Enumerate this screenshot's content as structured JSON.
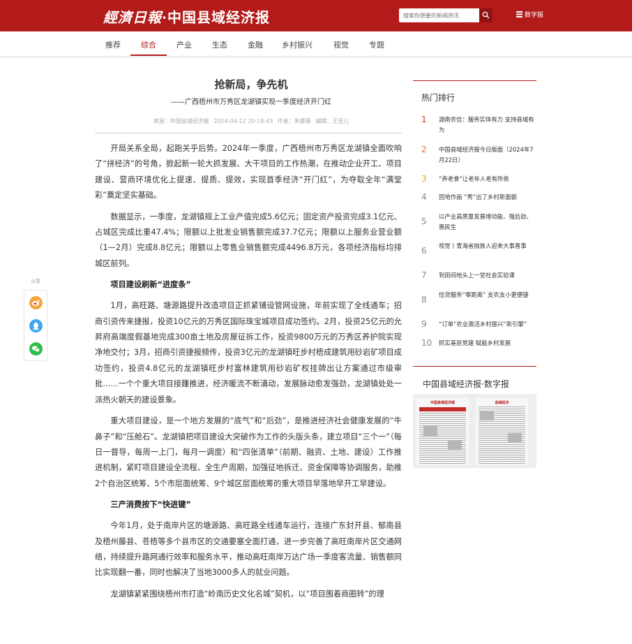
{
  "header": {
    "logo_script": "經濟日報",
    "logo_main": "中国县域经济报",
    "search_placeholder": "搜索你想要的新闻资讯",
    "digital_label": "数字报"
  },
  "nav": {
    "items": [
      "推荐",
      "综合",
      "产业",
      "生态",
      "金融",
      "乡村振兴",
      "视觉",
      "专题"
    ],
    "active": "综合"
  },
  "article": {
    "title": "抢新局，争先机",
    "subtitle": "——广西梧州市万秀区龙湖镇实现一季度经济开门红",
    "meta": {
      "source": "来源：中国县域经济报",
      "date": "2024-04-12 20:18:43",
      "author": "作者：朱娜蓉",
      "editor": "编辑：王昱儿"
    },
    "p1": "开局关系全局，起跑关乎后势。2024年一季度，广西梧州市万秀区龙湖镇全面吹响了“拼经济”的号角，掀起新一轮大抓发展、大干项目的工作热潮，在推动企业开工、项目建设、营商环境优化上提速、提质、提效，实现首季经济“开门红”，为夺取全年“满堂彩”奠定坚实基础。",
    "p2": "数据显示，一季度，龙湖镇规上工业产值完成5.6亿元；固定资产投资完成3.1亿元、占城区完成比重47.4%；限额以上批发业销售额完成37.7亿元；限额以上服务业营业额（1—2月）完成8.8亿元；限额以上零售业销售额完成4496.8万元，各项经济指标均排城区前列。",
    "h1": "项目建设刷新“进度条”",
    "p3": "1月，高旺路、塘源路提升改造项目正抓紧铺设管网设施，年前实现了全线通车；招商引资传来捷报，投资10亿元的万秀区国际珠宝城项目成功签约。2月，投资25亿元的允昇府高端度假基地完成300亩土地及房屋征拆工作，投资9800万元的万秀区养护院实现净地交付；3月，招商引资捷报频传，投资3亿元的龙湖镇旺步村梧成建筑用砂岩矿项目成功签约，投资4.8亿元的龙湖镇旺步村富林建筑用砂岩矿权挂牌出让方案通过市级审批……一个个重大项目接踵推进，经济暖流不断涌动，发展脉动愈发强劲，龙湖镇处处一派热火朝天的建设景象。",
    "p4": "重大项目建设，是一个地方发展的“底气”和“后劲”，是推进经济社会健康发展的“牛鼻子”和“压舱石”。龙湖镇把项目建设大突破作为工作的头版头条，建立项目“三个一”（每日一督导，每周一上门，每月一调度）和“四张清单”（前期、融资、土地、建设）工作推进机制，紧盯项目建设全流程、全生产周期，加强征地拆迁、资金保障等协调服务，助推2个自治区统筹、5个市层面统筹、9个城区层面统筹的重大项目早落地早开工早建设。",
    "h2": "三产消费按下“快进键”",
    "p5": "今年1月，处于南岸片区的塘源路、高旺路全线通车运行，连接广东封开县、郁南县及梧州藤县、苍梧等多个县市区的交通要塞全面打通，进一步完善了高旺南岸片区交通网络，持续提升路网通行效率和服务水平，推动高旺南岸万达广场一季度客流量、销售额同比实现翻一番，同时也解决了当地3000多人的就业问题。",
    "p6": "龙湖镇紧紧围绕梧州市打造“岭南历史文化名城”契机，以“项目围着商圈转”的理"
  },
  "share": {
    "label": "分享",
    "icons": [
      "weibo-icon",
      "qq-icon",
      "wechat-icon"
    ]
  },
  "hot": {
    "title": "热门排行",
    "items": [
      {
        "num": "1",
        "text": "湖南农信：服务实体有力 支持县域有为"
      },
      {
        "num": "2",
        "text": "中国县域经济报今日版面（2024年7月22日）"
      },
      {
        "num": "3",
        "text": "“养老食”让老年人老有所依"
      },
      {
        "num": "4",
        "text": "因地作画 “秀”出了乡村新面貌"
      },
      {
        "num": "5",
        "text": "以产业高质量发展增动能、强后劲、惠民生"
      },
      {
        "num": "6",
        "text": "视觉丨青海省抛族人迎来大事喜事"
      },
      {
        "num": "7",
        "text": "到田间地头上一堂社会实验课"
      },
      {
        "num": "8",
        "text": "信贷服务“零距离” 支农支小更便捷"
      },
      {
        "num": "9",
        "text": "“订单”农业激活乡村振兴“新引擎”"
      },
      {
        "num": "10",
        "text": "抓实基层党建 赋能乡村发展"
      }
    ],
    "colors": {
      "top1": "#e0301e",
      "top2": "#e8762d",
      "top3": "#e0a51e",
      "rest": "#888888"
    }
  },
  "paper": {
    "title": "中国县域经济报·数字报",
    "page1_mast": "中国县域经济报",
    "page2_mast": "县域经济"
  },
  "colors": {
    "brand": "#b31b1b"
  }
}
